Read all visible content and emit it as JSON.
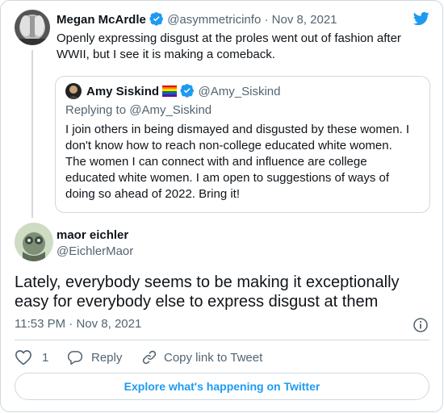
{
  "quoted_tweet": {
    "author_name": "Megan McArdle",
    "author_handle": "@asymmetricinfo",
    "separator": "·",
    "date": "Nov 8, 2021",
    "text_lines": [
      "Openly expressing disgust at the proles went out of fashion after",
      "WWII, but I see it is making a comeback."
    ],
    "verified": true,
    "avatar": "avatar-hands-over-face"
  },
  "nested_quote": {
    "author_name": "Amy Siskind",
    "author_handle": "@Amy_Siskind",
    "replying_to_prefix": "Replying to ",
    "replying_to_handle": "@Amy_Siskind",
    "text_lines": [
      "I join others in being dismayed and disgusted by these women.  I",
      "don't know how to reach non-college educated white women.",
      "The women I can connect with and influence are college",
      "educated white women. I am open to suggestions of ways of",
      "doing so ahead of 2022.  Bring it!"
    ],
    "verified": true,
    "name_emoji": "rainbow-flag"
  },
  "main_tweet": {
    "author_name": "maor eichler",
    "author_handle": "@EichlerMaor",
    "text_lines": [
      "Lately, everybody seems to be making it exceptionally",
      "easy for everybody else to express disgust at them"
    ],
    "time": "11:53 PM",
    "separator": "·",
    "date": "Nov 8, 2021"
  },
  "actions": {
    "like_count": "1",
    "reply_label": "Reply",
    "copy_link_label": "Copy link to Tweet"
  },
  "explore_label": "Explore what's happening on Twitter",
  "colors": {
    "brand_blue": "#1d9bf0",
    "text": "#0f1419",
    "secondary": "#536471",
    "border": "#cfd9de"
  },
  "icons": [
    "twitter-bird-icon",
    "verified-badge-icon",
    "rainbow-flag-icon",
    "info-icon",
    "heart-icon",
    "reply-icon",
    "link-icon"
  ]
}
